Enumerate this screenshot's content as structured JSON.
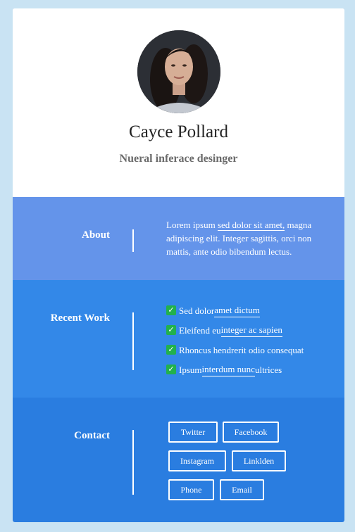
{
  "profile": {
    "name": "Cayce Pollard",
    "title": "Nueral inferace desinger"
  },
  "about": {
    "label": "About",
    "text_before": "Lorem ipsum ",
    "link_text": "sed dolor sit amet,",
    "text_after": " magna adipiscing elit. Integer sagittis, orci non mattis, ante odio bibendum lectus."
  },
  "recent_work": {
    "label": "Recent Work",
    "items": [
      {
        "before": "Sed dolor",
        "link": " amet dictum",
        "after": ""
      },
      {
        "before": "Eleifend eu",
        "link": " integer ac sapien",
        "after": ""
      },
      {
        "before": "Rhoncus hendrerit odio consequat",
        "link": "",
        "after": ""
      },
      {
        "before": "Ipsum ",
        "link": "interdum nunc ",
        "after": "ultrices"
      }
    ]
  },
  "contact": {
    "label": "Contact",
    "buttons": [
      "Twitter",
      "Facebook",
      "Instagram",
      "Linklden",
      "Phone",
      "Email"
    ]
  },
  "colors": {
    "page_bg": "#c9e3f3",
    "about_bg": "#6494ea",
    "work_bg": "#3388e8",
    "contact_bg": "#2a7de0",
    "check_green": "#22b14c"
  },
  "icons": {
    "check": "check-icon"
  }
}
